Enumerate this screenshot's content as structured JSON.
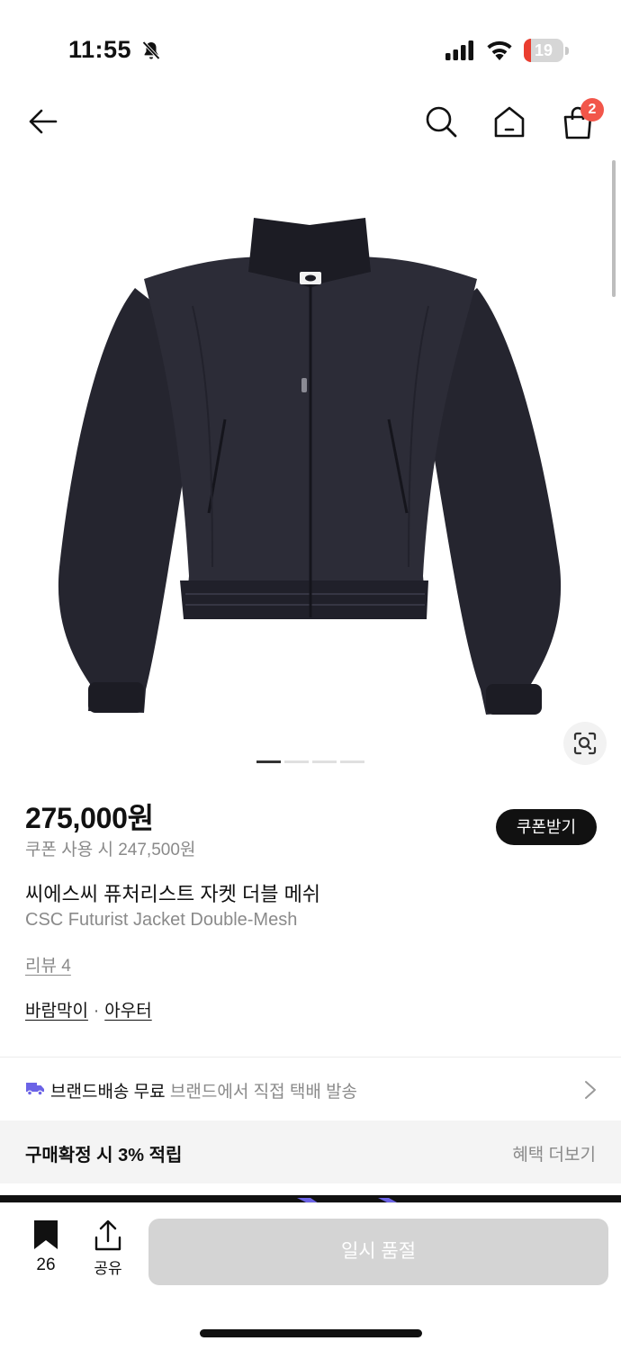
{
  "status_bar": {
    "time": "11:55",
    "battery_level": "19",
    "battery_fraction": 0.19,
    "battery_color": "#ea3d2f",
    "icons": [
      "bell-slash-icon",
      "signal-icon",
      "wifi-icon",
      "battery-icon"
    ]
  },
  "nav": {
    "icons": [
      "back-arrow-icon",
      "search-icon",
      "home-icon",
      "shopping-bag-icon"
    ],
    "cart_count": "2",
    "badge_color": "#f2564a"
  },
  "gallery": {
    "slide_count": 4,
    "active_slide": 1,
    "image": "black zip-up mesh track jacket",
    "lens_icon": "image-search-icon"
  },
  "product": {
    "price": "275,000원",
    "coupon_price": "쿠폰 사용 시 247,500원",
    "coupon_button": "쿠폰받기",
    "name_ko": "씨에스씨 퓨처리스트 자켓 더블 메쉬",
    "name_en": "CSC Futurist Jacket Double-Mesh",
    "review": "리뷰 4",
    "categories": [
      "바람막이",
      "아우터"
    ],
    "category_separator": "·"
  },
  "shipping": {
    "label": "브랜드배송 무료",
    "description": "브랜드에서 직접 택배 발송",
    "icon": "truck-icon",
    "icon_color": "#6b63e6"
  },
  "benefit": {
    "text": "구매확정 시 3% 적립",
    "more": "혜택 더보기"
  },
  "bottom_bar": {
    "bookmark_count": "26",
    "share_label": "공유",
    "soldout_label": "일시 품절"
  }
}
